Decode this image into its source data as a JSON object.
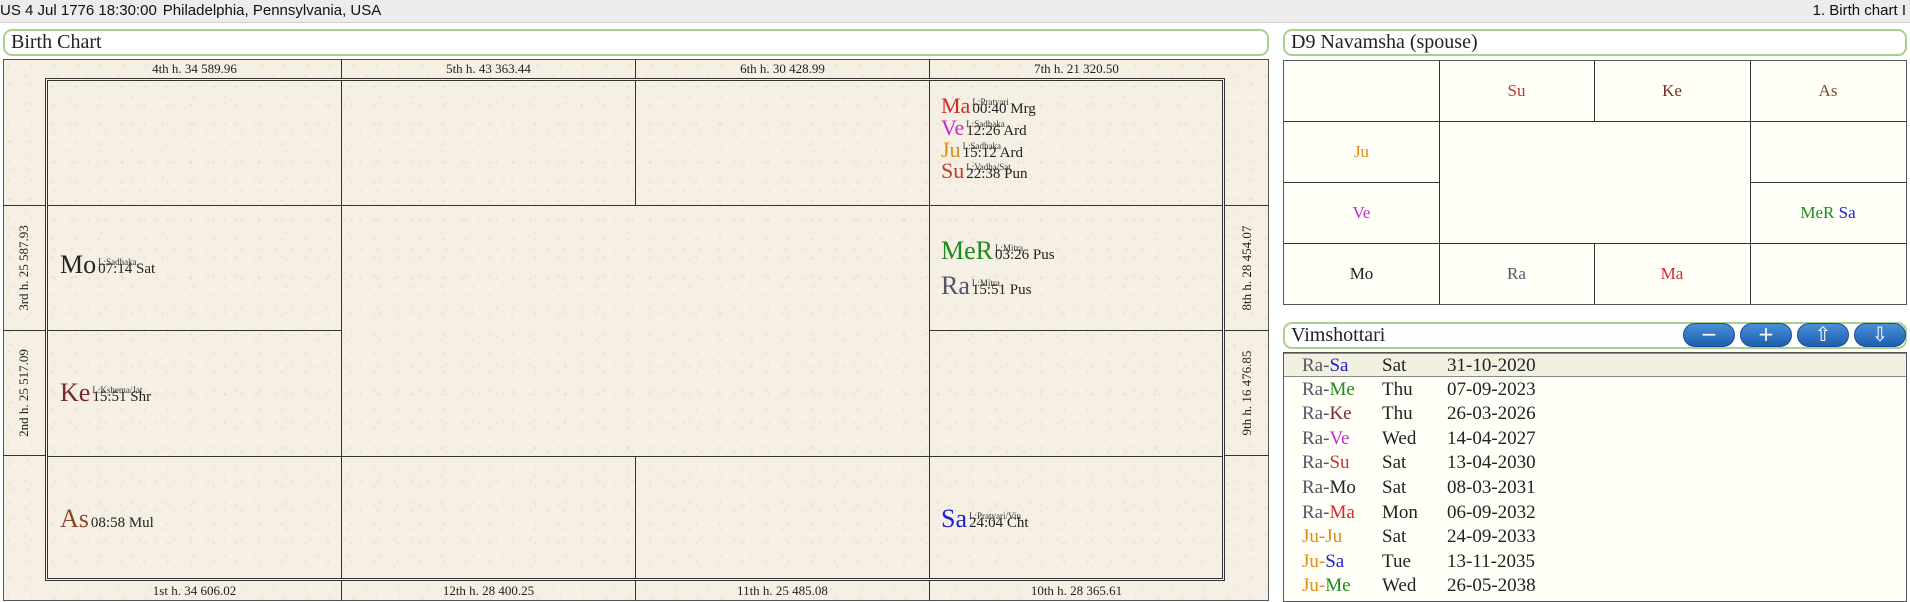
{
  "colors": {
    "Su": "#c0392b",
    "Mo": "#222222",
    "Ma": "#d42a2a",
    "Me": "#1f8a1f",
    "MeR": "#1f8a1f",
    "Ju": "#e08c12",
    "Ve": "#c12ccc",
    "Sa": "#1f1fd0",
    "Ra": "#555566",
    "Ke": "#7a2a2a",
    "As": "#8a4a2a",
    "accent_green": "#a9d08e",
    "button_blue": "#1d5fb0"
  },
  "topbar": {
    "datetime": "US 4 Jul 1776 18:30:00",
    "place": "Philadelphia, Pennsylvania, USA",
    "right_label": "1. Birth chart I"
  },
  "birth_chart": {
    "title": "Birth Chart",
    "house_labels": {
      "h4": "4th h.  34  589.96",
      "h5": "5th h.  43  363.44",
      "h6": "6th h.  30  428.99",
      "h7": "7th h.  21  320.50",
      "h3": "3rd h.  25  587.93",
      "h2": "2nd h.  25  517.09",
      "h8": "8th h.  28  454.07",
      "h9": "9th h.  16  476.85",
      "h1": "1st h.  34  606.02",
      "h12": "12th h.  28  400.25",
      "h11": "11th h.  25  485.08",
      "h10": "10th h.  28  365.61"
    },
    "planets": {
      "Ma_h7": {
        "abbr": "Ma",
        "lord": "L:Pratyari",
        "deg": "00:40 Mrg"
      },
      "Ve_h7": {
        "abbr": "Ve",
        "lord": "L:Sadhaka",
        "deg": "12:26 Ard"
      },
      "Ju_h7": {
        "abbr": "Ju",
        "lord": "L:Sadhaka",
        "deg": "15:12 Ard"
      },
      "Su_h7": {
        "abbr": "Su",
        "lord": "L:Vadha/Sat",
        "deg": "22:38 Pun"
      },
      "Mo_h3": {
        "abbr": "Mo",
        "lord": "L:Sadhaka",
        "deg": "07:14 Sat"
      },
      "MeR_h8": {
        "abbr": "MeR",
        "lord": "L:Mitra",
        "deg": "03:26 Pus"
      },
      "Ra_h8": {
        "abbr": "Ra",
        "lord": "L:Mitra",
        "deg": "15:51 Pus"
      },
      "Ke_h2": {
        "abbr": "Ke",
        "lord": "L:Kshema/Jat",
        "deg": "15:51 Shr"
      },
      "As_h1": {
        "abbr": "As",
        "lord": "",
        "deg": "08:58 Mul"
      },
      "Sa_h10": {
        "abbr": "Sa",
        "lord": "L:Pratyari/Vin",
        "deg": "24:04 Cht"
      }
    }
  },
  "d9": {
    "title": "D9 Navamsha  (spouse)",
    "cells": {
      "r0c1": "Su",
      "r0c2": "Ke",
      "r0c3": "As",
      "r1c0": "Ju",
      "r2c0": "Ve",
      "r2c3a": "MeR",
      "r2c3b": "Sa",
      "r3c0": "Mo",
      "r3c1": "Ra",
      "r3c2": "Ma"
    }
  },
  "vimshottari": {
    "title": "Vimshottari",
    "buttons": {
      "minus": "−",
      "plus": "+",
      "up": "⇧",
      "down": "⇩"
    },
    "rows": [
      {
        "a": "Ra",
        "b": "Sa",
        "day": "Sat",
        "date": "31-10-2020"
      },
      {
        "a": "Ra",
        "b": "Me",
        "day": "Thu",
        "date": "07-09-2023"
      },
      {
        "a": "Ra",
        "b": "Ke",
        "day": "Thu",
        "date": "26-03-2026"
      },
      {
        "a": "Ra",
        "b": "Ve",
        "day": "Wed",
        "date": "14-04-2027"
      },
      {
        "a": "Ra",
        "b": "Su",
        "day": "Sat",
        "date": "13-04-2030"
      },
      {
        "a": "Ra",
        "b": "Mo",
        "day": "Sat",
        "date": "08-03-2031"
      },
      {
        "a": "Ra",
        "b": "Ma",
        "day": "Mon",
        "date": "06-09-2032"
      },
      {
        "a": "Ju",
        "b": "Ju",
        "day": "Sat",
        "date": "24-09-2033"
      },
      {
        "a": "Ju",
        "b": "Sa",
        "day": "Tue",
        "date": "13-11-2035"
      },
      {
        "a": "Ju",
        "b": "Me",
        "day": "Wed",
        "date": "26-05-2038"
      }
    ]
  }
}
